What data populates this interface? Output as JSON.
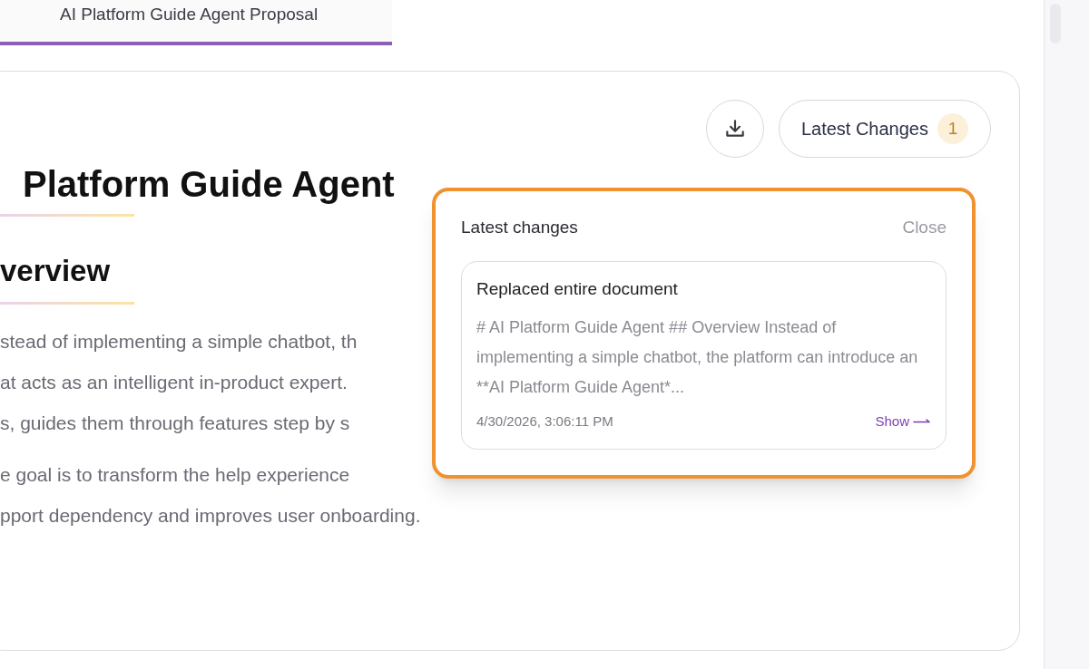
{
  "tab": {
    "title": "AI Platform Guide Agent Proposal",
    "selected": true
  },
  "toolbar": {
    "changes_button": {
      "label": "Latest Changes",
      "count": "1"
    }
  },
  "document": {
    "heading": "Platform Guide Agent",
    "subheading": "verview",
    "paragraphs": [
      [
        "stead of implementing a simple chatbot, th",
        "at acts as an intelligent in-product expert.",
        "s, guides them through features step by s"
      ],
      [
        "e goal is to transform the help experience",
        "pport dependency and improves user onboarding."
      ]
    ]
  },
  "popover": {
    "title": "Latest changes",
    "close": "Close",
    "changes": [
      {
        "title": "Replaced entire document",
        "preview": "# AI Platform Guide Agent ## Overview Instead of implementing a simple chatbot, the platform can introduce an **AI Platform Guide Agent*...",
        "time": "4/30/2026, 3:06:11 PM",
        "action": "Show"
      }
    ]
  }
}
